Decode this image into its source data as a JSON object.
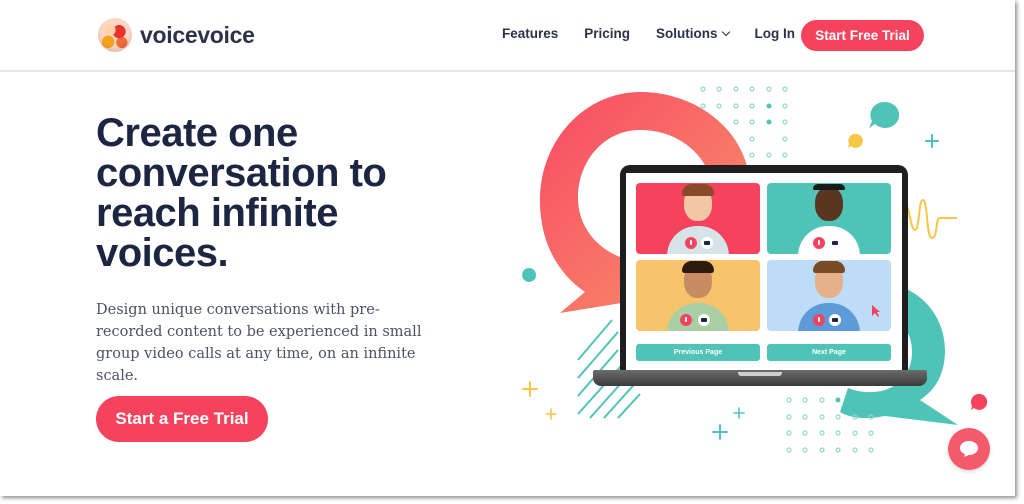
{
  "brand": {
    "name": "voicevoice",
    "logo_icon": "globe-speech-logo"
  },
  "nav": {
    "items": [
      {
        "label": "Features"
      },
      {
        "label": "Pricing"
      },
      {
        "label": "Solutions",
        "has_dropdown": true
      },
      {
        "label": "Log In"
      }
    ],
    "cta_label": "Start Free Trial"
  },
  "hero": {
    "title": "Create one conversation to reach infinite voices.",
    "subtitle": "Design unique conversations with pre-recorded content to be experienced in small group video calls at any time, on an infinite scale.",
    "cta_label": "Start a Free Trial"
  },
  "illustration": {
    "video_tiles": [
      {
        "bg": "#f5435e"
      },
      {
        "bg": "#4fc3b8"
      },
      {
        "bg": "#f7c46c"
      },
      {
        "bg": "#bcdcf7"
      }
    ],
    "prev_label": "Previous Page",
    "next_label": "Next Page"
  },
  "colors": {
    "accent": "#f5435e",
    "teal": "#4fc3b8",
    "yellow": "#f7c646",
    "heading": "#1c2541",
    "body_text": "#4b5266"
  },
  "chat_widget": {
    "icon": "chat-bubble-icon"
  }
}
